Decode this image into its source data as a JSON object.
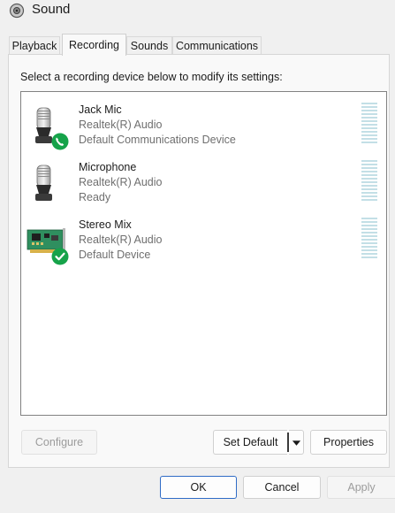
{
  "window": {
    "title": "Sound",
    "icon": "speaker-icon"
  },
  "tabs": [
    {
      "label": "Playback",
      "active": false
    },
    {
      "label": "Recording",
      "active": true
    },
    {
      "label": "Sounds",
      "active": false
    },
    {
      "label": "Communications",
      "active": false
    }
  ],
  "instructions": "Select a recording device below to modify its settings:",
  "devices": [
    {
      "name": "Jack Mic",
      "driver": "Realtek(R) Audio",
      "status": "Default Communications Device",
      "icon": "microphone-icon",
      "badge": "phone-badge-icon"
    },
    {
      "name": "Microphone",
      "driver": "Realtek(R) Audio",
      "status": "Ready",
      "icon": "microphone-icon",
      "badge": ""
    },
    {
      "name": "Stereo Mix",
      "driver": "Realtek(R) Audio",
      "status": "Default Device",
      "icon": "sound-card-icon",
      "badge": "checkmark-badge-icon"
    }
  ],
  "buttons": {
    "configure": "Configure",
    "set_default": "Set Default",
    "properties": "Properties",
    "ok": "OK",
    "cancel": "Cancel",
    "apply": "Apply"
  },
  "colors": {
    "badge_green": "#16a34a",
    "meter": "#c3dfe6",
    "focus_border": "#2f6cc6"
  }
}
